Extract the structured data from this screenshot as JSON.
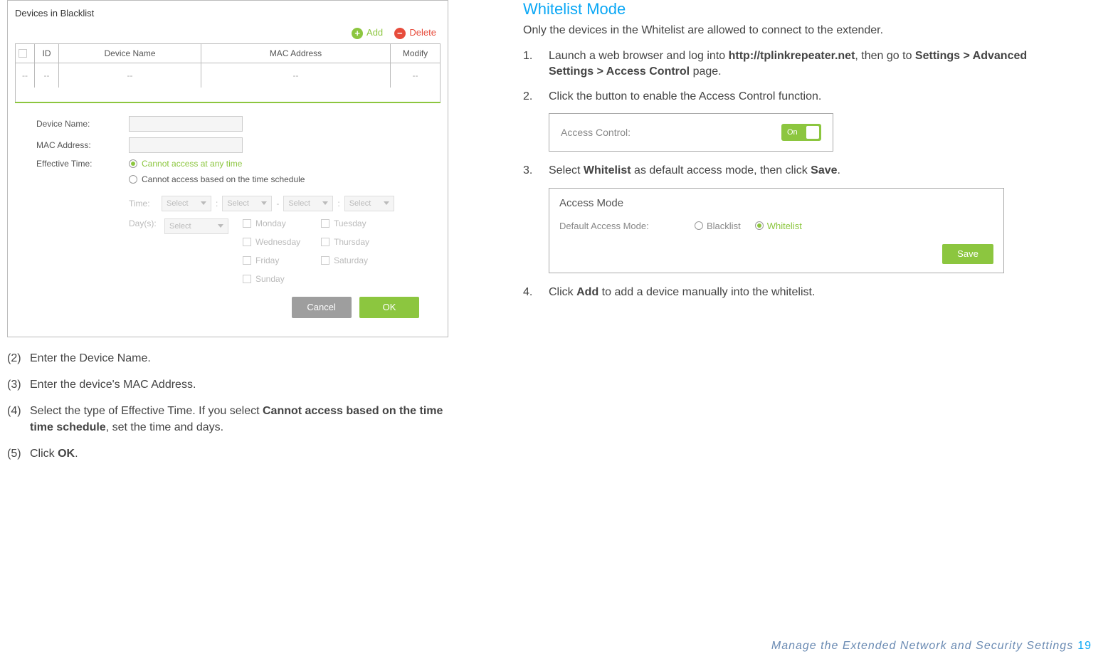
{
  "blacklist_panel": {
    "title": "Devices in Blacklist",
    "add_label": "Add",
    "delete_label": "Delete",
    "columns": {
      "id": "ID",
      "device_name": "Device Name",
      "mac": "MAC Address",
      "modify": "Modify"
    },
    "empty_cell": "--",
    "form": {
      "device_name_label": "Device Name:",
      "mac_label": "MAC Address:",
      "eff_time_label": "Effective Time:",
      "opt1": "Cannot access at any time",
      "opt2": "Cannot access based on the time schedule",
      "time_label": "Time:",
      "select_placeholder": "Select",
      "days_label": "Day(s):",
      "days": {
        "mon": "Monday",
        "tue": "Tuesday",
        "wed": "Wednesday",
        "thu": "Thursday",
        "fri": "Friday",
        "sat": "Saturday",
        "sun": "Sunday"
      },
      "cancel": "Cancel",
      "ok": "OK"
    }
  },
  "left_steps": {
    "s2_num": "(2)",
    "s2": "Enter the Device Name.",
    "s3_num": "(3)",
    "s3": "Enter the device's MAC Address.",
    "s4_num": "(4)",
    "s4_a": "Select the type of Effective Time. If you select ",
    "s4_b": "Cannot access based on the time time schedule",
    "s4_c": ", set the time and days.",
    "s5_num": "(5)",
    "s5_a": "Click ",
    "s5_b": "OK",
    "s5_c": "."
  },
  "right": {
    "heading": "Whitelist Mode",
    "intro": "Only the devices in the Whitelist are allowed to connect to the extender.",
    "n1": "1.",
    "step1_a": "Launch a web browser and log into ",
    "step1_b": "http://tplinkrepeater.net",
    "step1_c": ", then go to ",
    "step1_d": "Settings > Advanced Settings > Access Control",
    "step1_e": " page.",
    "n2": "2.",
    "step2": "Click the button to enable the Access Control function.",
    "ac_label": "Access Control:",
    "toggle_text": "On",
    "n3": "3.",
    "step3_a": "Select ",
    "step3_b": "Whitelist",
    "step3_c": " as default access mode, then click ",
    "step3_d": "Save",
    "step3_e": ".",
    "am_title": "Access Mode",
    "am_label": "Default Access Mode:",
    "am_blacklist": "Blacklist",
    "am_whitelist": "Whitelist",
    "save": "Save",
    "n4": "4.",
    "step4_a": "Click ",
    "step4_b": "Add",
    "step4_c": " to add a device manually into the whitelist."
  },
  "footer": {
    "text": "Manage the Extended Network and Security Settings",
    "page": "19"
  }
}
